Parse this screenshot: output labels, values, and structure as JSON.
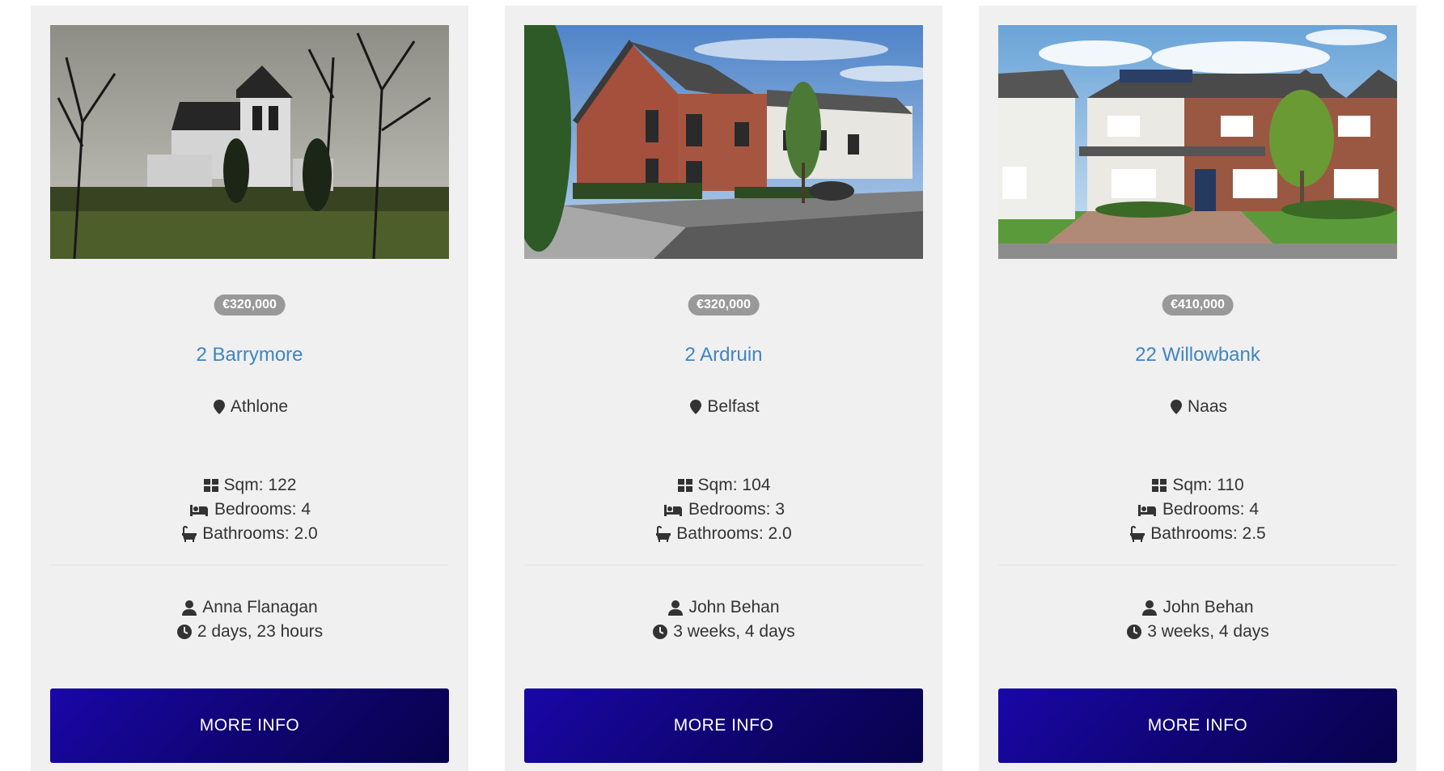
{
  "listings": [
    {
      "price": "€320,000",
      "title": "2 Barrymore",
      "location": "Athlone",
      "sqm": "Sqm: 122",
      "bedrooms": "Bedrooms: 4",
      "bathrooms": "Bathrooms: 2.0",
      "agent": "Anna Flanagan",
      "posted": "2 days, 23 hours",
      "button": "MORE INFO"
    },
    {
      "price": "€320,000",
      "title": "2 Ardruin",
      "location": "Belfast",
      "sqm": "Sqm: 104",
      "bedrooms": "Bedrooms: 3",
      "bathrooms": "Bathrooms: 2.0",
      "agent": "John Behan",
      "posted": "3 weeks, 4 days",
      "button": "MORE INFO"
    },
    {
      "price": "€410,000",
      "title": "22 Willowbank",
      "location": "Naas",
      "sqm": "Sqm: 110",
      "bedrooms": "Bedrooms: 4",
      "bathrooms": "Bathrooms: 2.5",
      "agent": "John Behan",
      "posted": "3 weeks, 4 days",
      "button": "MORE INFO"
    }
  ],
  "colors": {
    "card_bg": "#f0f0f0",
    "title_link": "#3f85c2",
    "price_badge": "#999999",
    "button_gradient_start": "#1a07a8",
    "button_gradient_end": "#08024a"
  },
  "icons": {
    "location": "map-marker-icon",
    "sqm": "grid-icon",
    "bedrooms": "bed-icon",
    "bathrooms": "bath-icon",
    "agent": "user-icon",
    "posted": "clock-icon"
  }
}
